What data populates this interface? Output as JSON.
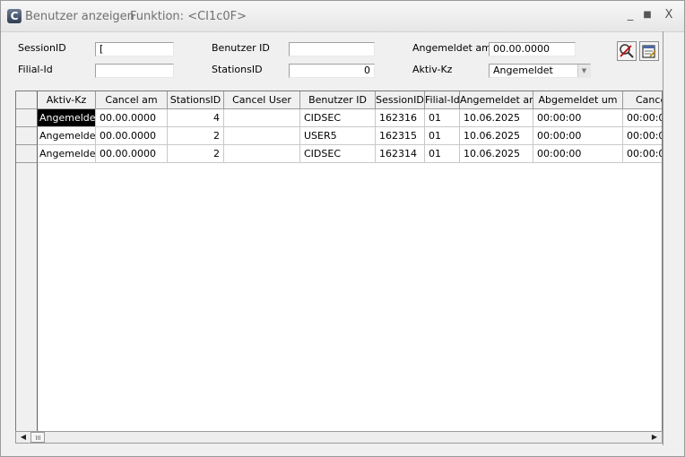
{
  "window": {
    "title": "Benutzer anzeigen",
    "function_label": "Funktion: <CI1c0F>",
    "app_icon_letter": "C"
  },
  "controls": {
    "minimize": "_",
    "maximize": "■",
    "close": "X"
  },
  "form": {
    "session_id": {
      "label": "SessionID",
      "value": "["
    },
    "filial_id": {
      "label": "Filial-Id",
      "value": ""
    },
    "benutzer_id": {
      "label": "Benutzer ID",
      "value": ""
    },
    "stations_id": {
      "label": "StationsID",
      "value": "0"
    },
    "angemeldet_am": {
      "label": "Angemeldet am",
      "value": "00.00.0000"
    },
    "aktiv_kz": {
      "label": "Aktiv-Kz",
      "value": "Angemeldet"
    }
  },
  "buttons": {
    "search_icon": "search-clear-icon",
    "notes_icon": "notes-icon"
  },
  "table": {
    "columns": [
      "Aktiv-Kz",
      "Cancel am",
      "StationsID",
      "Cancel User",
      "Benutzer ID",
      "SessionID",
      "Filial-Id",
      "Angemeldet am",
      "Abgemeldet um",
      "Cance"
    ],
    "rows": [
      [
        "Angemelde",
        "00.00.0000",
        "4",
        "",
        "CIDSEC",
        "162316",
        "01",
        "10.06.2025",
        "00:00:00",
        "00:00:0"
      ],
      [
        "Angemelde",
        "00.00.0000",
        "2",
        "",
        "USER5",
        "162315",
        "01",
        "10.06.2025",
        "00:00:00",
        "00:00:0"
      ],
      [
        "Angemelde",
        "00.00.0000",
        "2",
        "",
        "CIDSEC",
        "162314",
        "01",
        "10.06.2025",
        "00:00:00",
        "00:00:0"
      ]
    ]
  },
  "colors": {
    "selected_cell_bg": "#000000",
    "selected_cell_fg": "#ffffff",
    "window_bg": "#f0f0f0"
  }
}
